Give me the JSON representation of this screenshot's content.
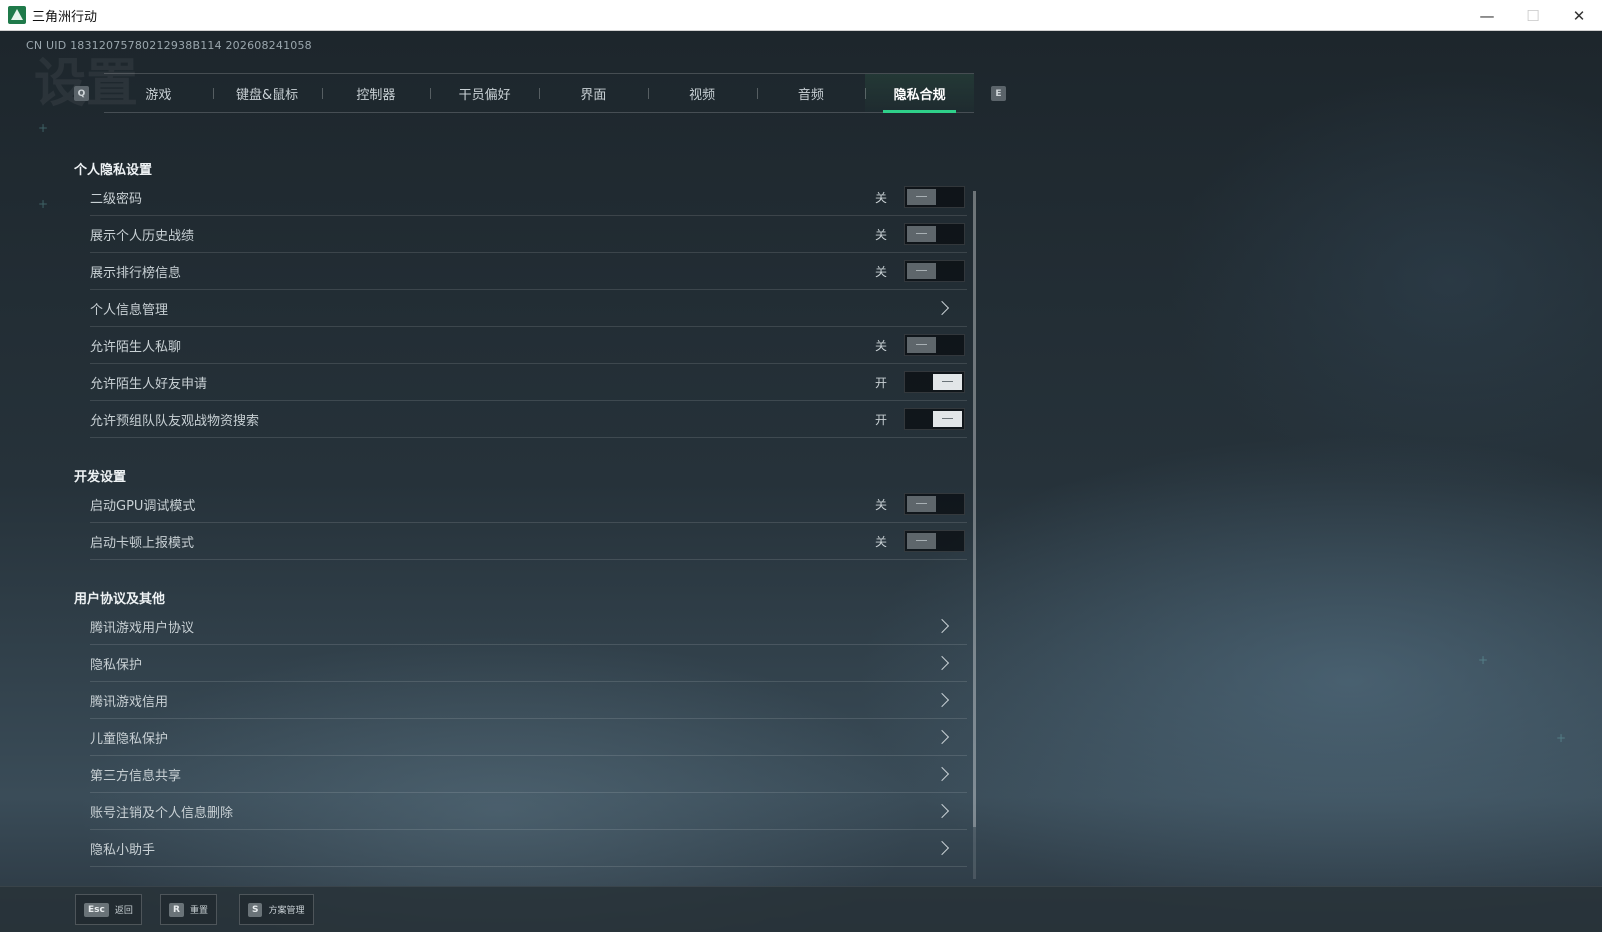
{
  "window": {
    "title": "三角洲行动",
    "minimize": "—",
    "maximize": "☐",
    "close": "✕"
  },
  "uid": "CN UID 18312075780212938B114 202608241058",
  "tab_keys": {
    "left": "Q",
    "right": "E"
  },
  "tabs": [
    {
      "label": "游戏",
      "active": false
    },
    {
      "label": "键盘&鼠标",
      "active": false
    },
    {
      "label": "控制器",
      "active": false
    },
    {
      "label": "干员偏好",
      "active": false
    },
    {
      "label": "界面",
      "active": false
    },
    {
      "label": "视频",
      "active": false
    },
    {
      "label": "音频",
      "active": false
    },
    {
      "label": "隐私合规",
      "active": true
    }
  ],
  "sections": {
    "privacy": {
      "title": "个人隐私设置",
      "rows": [
        {
          "label": "二级密码",
          "state": "关",
          "on": false
        },
        {
          "label": "展示个人历史战绩",
          "state": "关",
          "on": false
        },
        {
          "label": "展示排行榜信息",
          "state": "关",
          "on": false
        },
        {
          "label": "个人信息管理"
        },
        {
          "label": "允许陌生人私聊",
          "state": "关",
          "on": false
        },
        {
          "label": "允许陌生人好友申请",
          "state": "开",
          "on": true
        },
        {
          "label": "允许预组队队友观战物资搜索",
          "state": "开",
          "on": true
        }
      ]
    },
    "dev": {
      "title": "开发设置",
      "rows": [
        {
          "label": "启动GPU调试模式",
          "state": "关",
          "on": false
        },
        {
          "label": "启动卡顿上报模式",
          "state": "关",
          "on": false
        }
      ]
    },
    "agreements": {
      "title": "用户协议及其他",
      "rows": [
        {
          "label": "腾讯游戏用户协议"
        },
        {
          "label": "隐私保护"
        },
        {
          "label": "腾讯游戏信用"
        },
        {
          "label": "儿童隐私保护"
        },
        {
          "label": "第三方信息共享"
        },
        {
          "label": "账号注销及个人信息删除"
        },
        {
          "label": "隐私小助手"
        }
      ]
    }
  },
  "bottom": {
    "back": {
      "key": "Esc",
      "label": "返回"
    },
    "reset": {
      "key": "R",
      "label": "重置"
    },
    "scheme": {
      "key": "S",
      "label": "方案管理"
    }
  },
  "colors": {
    "accent": "#2fd08a",
    "toggle_on": "#e2e6e8",
    "toggle_off": "#5e666b"
  },
  "icons": {
    "app": "delta-force-logo-icon",
    "row_arrow": "chevron-right-icon"
  }
}
